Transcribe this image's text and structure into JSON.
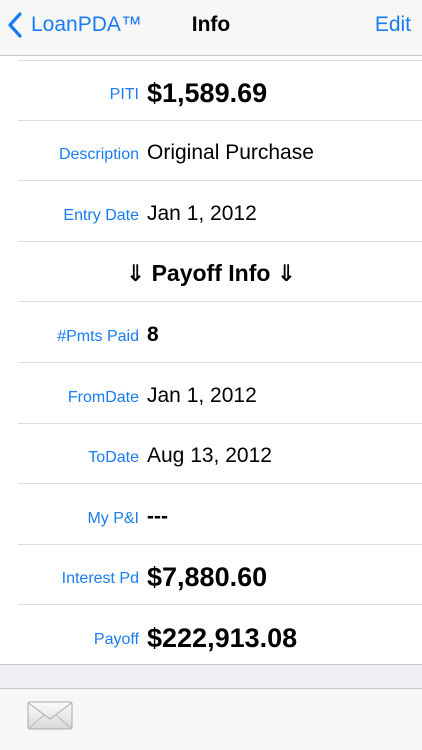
{
  "nav": {
    "back_label": "LoanPDA™",
    "title": "Info",
    "edit_label": "Edit"
  },
  "rows": [
    {
      "label": "PITI",
      "value": "$1,589.69"
    },
    {
      "label": "Description",
      "value": "Original Purchase"
    },
    {
      "label": "Entry Date",
      "value": "Jan 1, 2012"
    },
    {
      "header": "⇓ Payoff Info ⇓"
    },
    {
      "label": "#Pmts Paid",
      "value": "8"
    },
    {
      "label": "FromDate",
      "value": "Jan 1, 2012"
    },
    {
      "label": "ToDate",
      "value": "Aug 13, 2012"
    },
    {
      "label": "My P&I",
      "value": "---"
    },
    {
      "label": "Interest Pd",
      "value": "$7,880.60"
    },
    {
      "label": "Payoff",
      "value": "$222,913.08"
    }
  ],
  "toolbar": {
    "mail_icon": "mail-envelope-icon"
  },
  "colors": {
    "accent": "#1a7cf5",
    "background": "#efeff4",
    "row_background": "#ffffff"
  }
}
